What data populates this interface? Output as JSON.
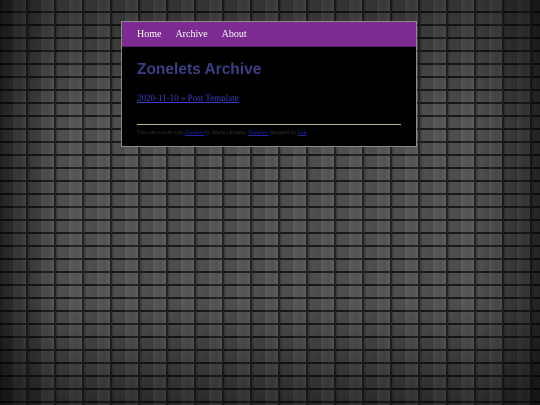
{
  "nav": {
    "items": [
      {
        "label": "Home"
      },
      {
        "label": "Archive"
      },
      {
        "label": "About"
      }
    ]
  },
  "page": {
    "title": "Zonelets Archive"
  },
  "posts": [
    {
      "link_text": "2020-11-10 » Post Template"
    }
  ],
  "footer": {
    "prefix": "This site is built with ",
    "link1": "Zonelets",
    "mid1": " by Marina Kittaka. ",
    "link2": "Template",
    "mid2": " designed by ",
    "link3": "link",
    "suffix": "."
  },
  "colors": {
    "nav_bg": "#7b2b91",
    "title": "#3b3f85",
    "link": "#3d3fc6",
    "panel_bg": "#000000"
  }
}
